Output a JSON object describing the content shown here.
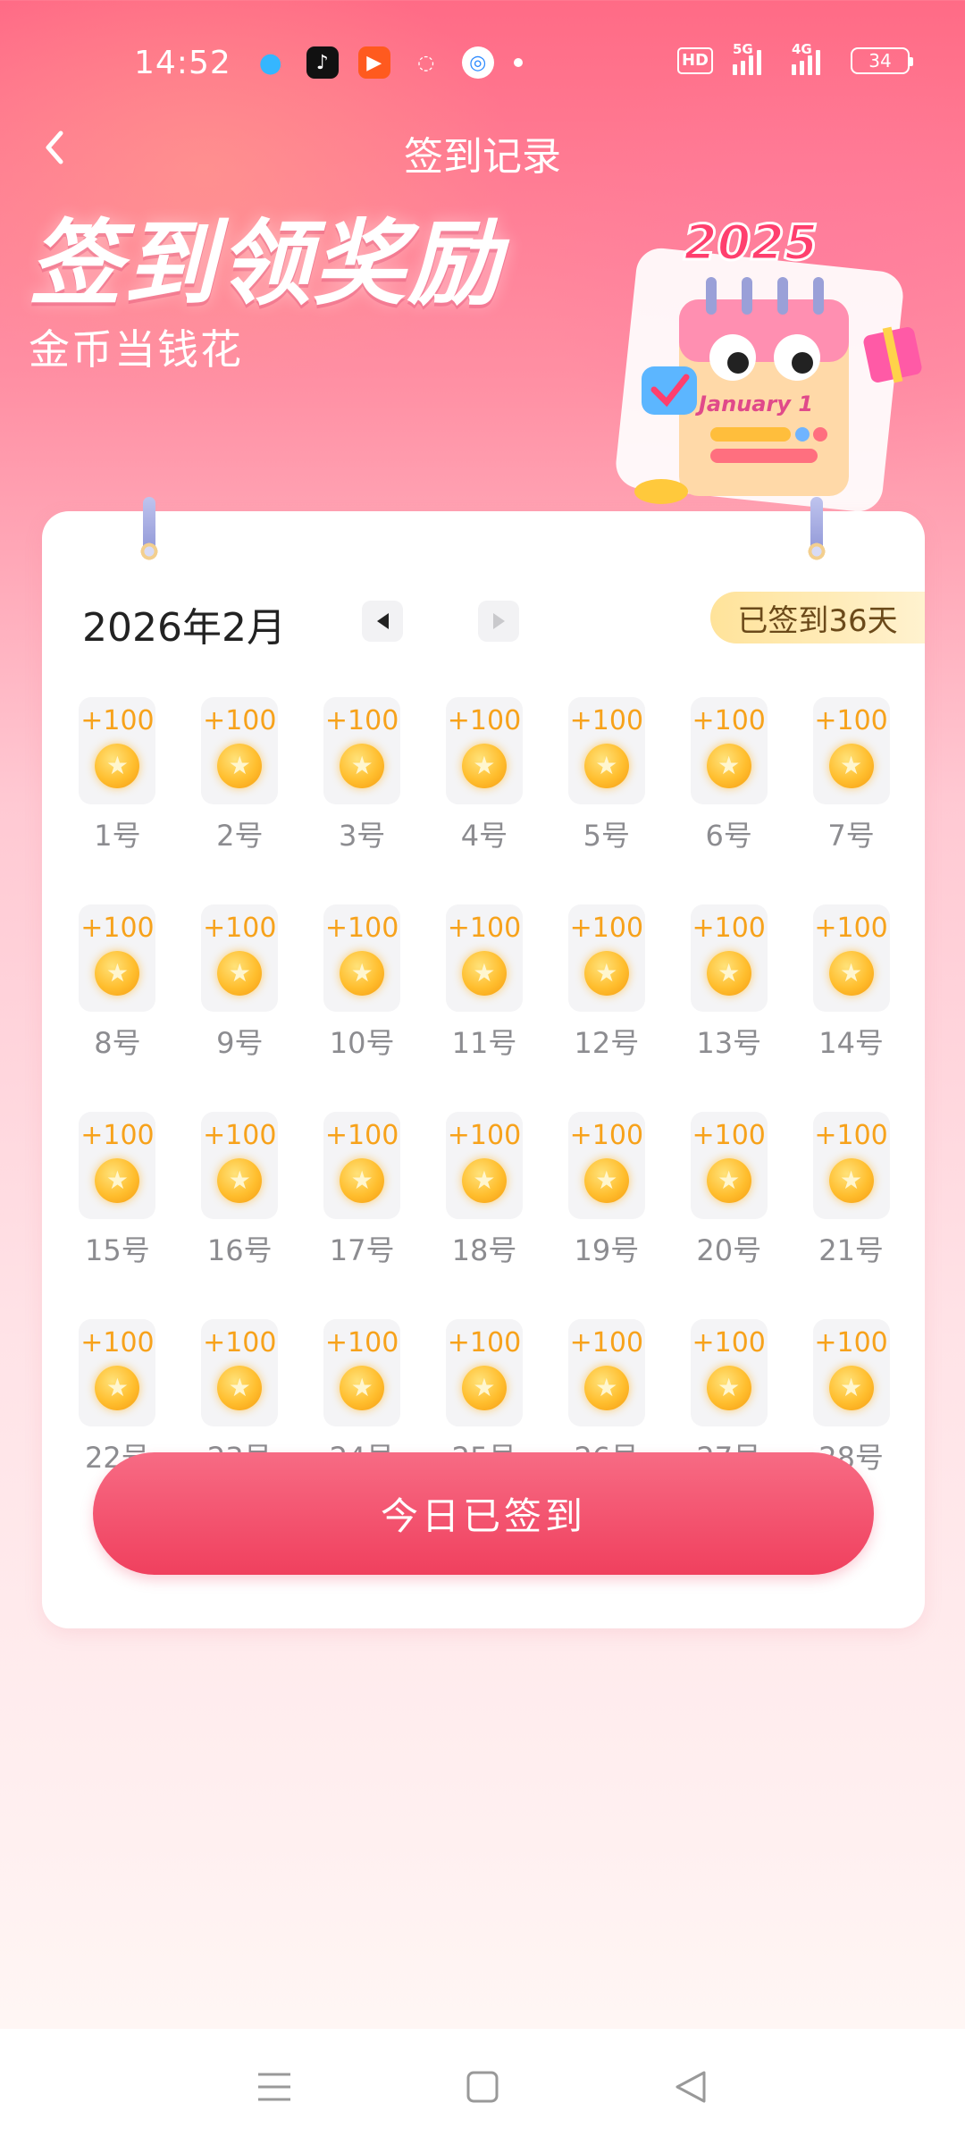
{
  "status_bar": {
    "time": "14:52",
    "network_a": "5G",
    "network_b": "4G",
    "hd_label": "HD",
    "battery": "34"
  },
  "nav": {
    "title": "签到记录",
    "back_icon": "chevron-left-icon"
  },
  "hero": {
    "title": "签到领奖励",
    "subtitle": "金币当钱花",
    "illustration_year": "2025",
    "illustration_text": "January 1"
  },
  "calendar": {
    "month": "2026年2月",
    "signed_badge": "已签到36天",
    "days": [
      {
        "reward": "+100",
        "label": "1号"
      },
      {
        "reward": "+100",
        "label": "2号"
      },
      {
        "reward": "+100",
        "label": "3号"
      },
      {
        "reward": "+100",
        "label": "4号"
      },
      {
        "reward": "+100",
        "label": "5号"
      },
      {
        "reward": "+100",
        "label": "6号"
      },
      {
        "reward": "+100",
        "label": "7号"
      },
      {
        "reward": "+100",
        "label": "8号"
      },
      {
        "reward": "+100",
        "label": "9号"
      },
      {
        "reward": "+100",
        "label": "10号"
      },
      {
        "reward": "+100",
        "label": "11号"
      },
      {
        "reward": "+100",
        "label": "12号"
      },
      {
        "reward": "+100",
        "label": "13号"
      },
      {
        "reward": "+100",
        "label": "14号"
      },
      {
        "reward": "+100",
        "label": "15号"
      },
      {
        "reward": "+100",
        "label": "16号"
      },
      {
        "reward": "+100",
        "label": "17号"
      },
      {
        "reward": "+100",
        "label": "18号"
      },
      {
        "reward": "+100",
        "label": "19号"
      },
      {
        "reward": "+100",
        "label": "20号"
      },
      {
        "reward": "+100",
        "label": "21号"
      },
      {
        "reward": "+100",
        "label": "22号"
      },
      {
        "reward": "+100",
        "label": "23号"
      },
      {
        "reward": "+100",
        "label": "24号"
      },
      {
        "reward": "+100",
        "label": "25号"
      },
      {
        "reward": "+100",
        "label": "26号"
      },
      {
        "reward": "+100",
        "label": "27号"
      },
      {
        "reward": "+100",
        "label": "28号"
      }
    ],
    "button_label": "今日已签到"
  },
  "colors": {
    "accent": "#f0405e",
    "reward": "#f7a21b",
    "badge_bg": "#ffe39a"
  }
}
